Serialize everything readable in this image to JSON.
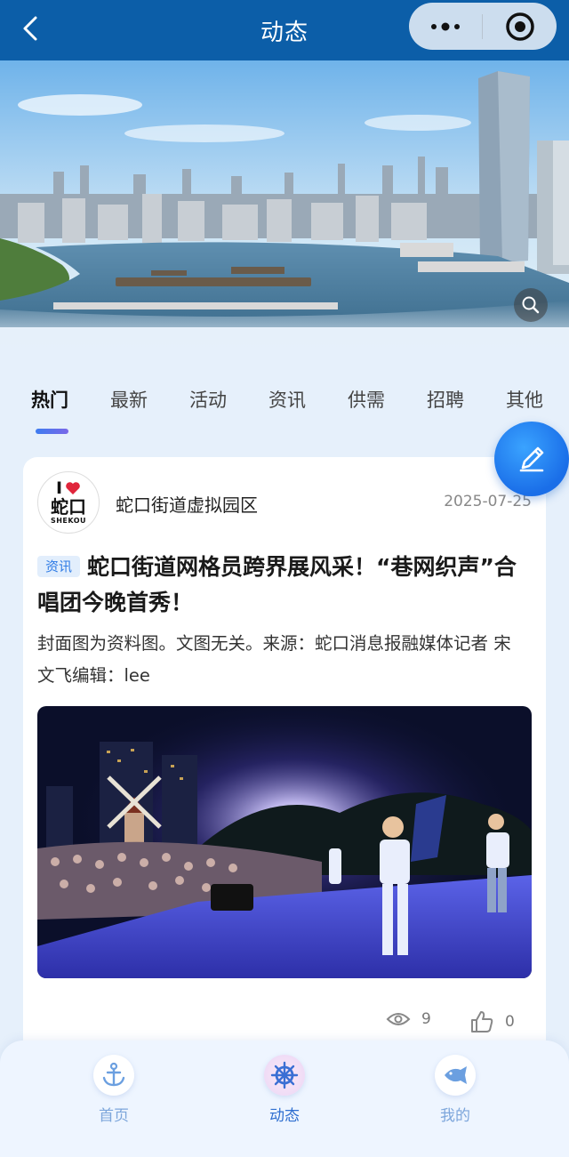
{
  "topbar": {
    "title": "动态",
    "back_icon": "chevron-left-icon",
    "more_icon": "more-dots-icon",
    "close_icon": "record-circle-icon"
  },
  "banner": {
    "zoom_icon": "search-icon"
  },
  "tabs": [
    {
      "label": "热门",
      "active": true
    },
    {
      "label": "最新",
      "active": false
    },
    {
      "label": "活动",
      "active": false
    },
    {
      "label": "资讯",
      "active": false
    },
    {
      "label": "供需",
      "active": false
    },
    {
      "label": "招聘",
      "active": false
    },
    {
      "label": "其他",
      "active": false
    }
  ],
  "fab": {
    "icon": "pencil-edit-icon"
  },
  "post": {
    "avatar": {
      "line1": "I",
      "line2": "蛇口",
      "line3": "SHEKOU"
    },
    "author": "蛇口街道虚拟园区",
    "date": "2025-07-25",
    "category": "资讯",
    "title": "蛇口街道网格员跨界展风采！“巷网织声”合唱团今晚首秀！",
    "summary": "封面图为资料图。文图无关。来源：蛇口消息报融媒体记者 宋文飞编辑：lee",
    "views": "9",
    "likes": "0"
  },
  "bottom_nav": [
    {
      "label": "首页",
      "icon": "anchor-icon",
      "active": false
    },
    {
      "label": "动态",
      "icon": "ship-wheel-icon",
      "active": true
    },
    {
      "label": "我的",
      "icon": "fish-icon",
      "active": false
    }
  ],
  "colors": {
    "header": "#0c5ea8",
    "accent": "#2f7be5",
    "background": "#e6f0fb"
  }
}
